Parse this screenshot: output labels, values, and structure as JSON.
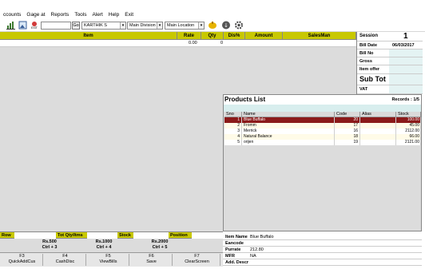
{
  "menu": [
    "ccounts",
    "Gage at",
    "Reports",
    "Tools",
    "Alert",
    "Help",
    "Exit"
  ],
  "toolbar": {
    "icons": [
      "bar-chart-icon",
      "image-icon",
      "exit-icon",
      "weighing-icon",
      "refresh-icon",
      "info-icon",
      "gear-icon"
    ],
    "exit_label": "EXIT",
    "search_value": "",
    "go_label": "Go",
    "salesman_value": "KARTHIK S",
    "division_value": "Main Division",
    "location_value": "Main Location"
  },
  "grid": {
    "columns": [
      "Item",
      "Rate",
      "Qty",
      "Dis%",
      "Amount",
      "SalesMan"
    ],
    "row": {
      "rate": "0.00",
      "qty": "0"
    }
  },
  "summary": {
    "session_label": "Session",
    "session_value": "1",
    "bill_date_label": "Bill Date",
    "bill_date_value": "06/03/2017",
    "bill_no_label": "Bill No",
    "gross_label": "Gross",
    "item_offer_label": "Item offer",
    "sub_tot_label": "Sub Tot",
    "vat_label": "VAT"
  },
  "products": {
    "title": "Products List",
    "records": "Records : 1/5",
    "columns": [
      "Sno",
      "Name",
      "Code",
      "Alias",
      "Stock"
    ],
    "rows": [
      {
        "sno": "1",
        "name": "Blue Buffalo",
        "code": "20",
        "alias": "",
        "stock": "100.00"
      },
      {
        "sno": "2",
        "name": "Fromm",
        "code": "17",
        "alias": "",
        "stock": "45.00"
      },
      {
        "sno": "3",
        "name": "Merrick",
        "code": "16",
        "alias": "",
        "stock": "2112.00"
      },
      {
        "sno": "4",
        "name": "Natural Balance",
        "code": "18",
        "alias": "",
        "stock": "66.00"
      },
      {
        "sno": "5",
        "name": "orijen",
        "code": "19",
        "alias": "",
        "stock": "2121.00"
      }
    ]
  },
  "status": {
    "row_label": "Row",
    "tot_qty_label": "Tot Qty/Itms",
    "stock_label": "Stock",
    "position_label": "Position"
  },
  "offers": [
    {
      "line1": "Rs.500",
      "line2": "Ctrl + 3"
    },
    {
      "line1": "Rs.1000",
      "line2": "Ctrl + 4"
    },
    {
      "line1": "Rs.2000",
      "line2": "Ctrl + 5"
    }
  ],
  "item_info": {
    "item_name_label": "Item Name",
    "item_name_value": "Blue Buffalo",
    "eancode_label": "Eancode",
    "eancode_value": "",
    "purrate_label": "Purrate",
    "purrate_value": "212.80",
    "mfr_label": "MFR",
    "mfr_value": "NA",
    "add_desc_label": "Add. Descr",
    "add_desc_value": ""
  },
  "fkeys": [
    {
      "key": "F3",
      "label": "QuickAddCus"
    },
    {
      "key": "F4",
      "label": "CashDisc"
    },
    {
      "key": "F5",
      "label": "ViewBills"
    },
    {
      "key": "F6",
      "label": "Save"
    },
    {
      "key": "F7",
      "label": "ClearScreen"
    }
  ],
  "colors": {
    "header_yellow": "#c8c800",
    "selected_row": "#8b1a1a",
    "value_cell": "#e4f3f3",
    "panel_grey": "#dcdcdc"
  }
}
